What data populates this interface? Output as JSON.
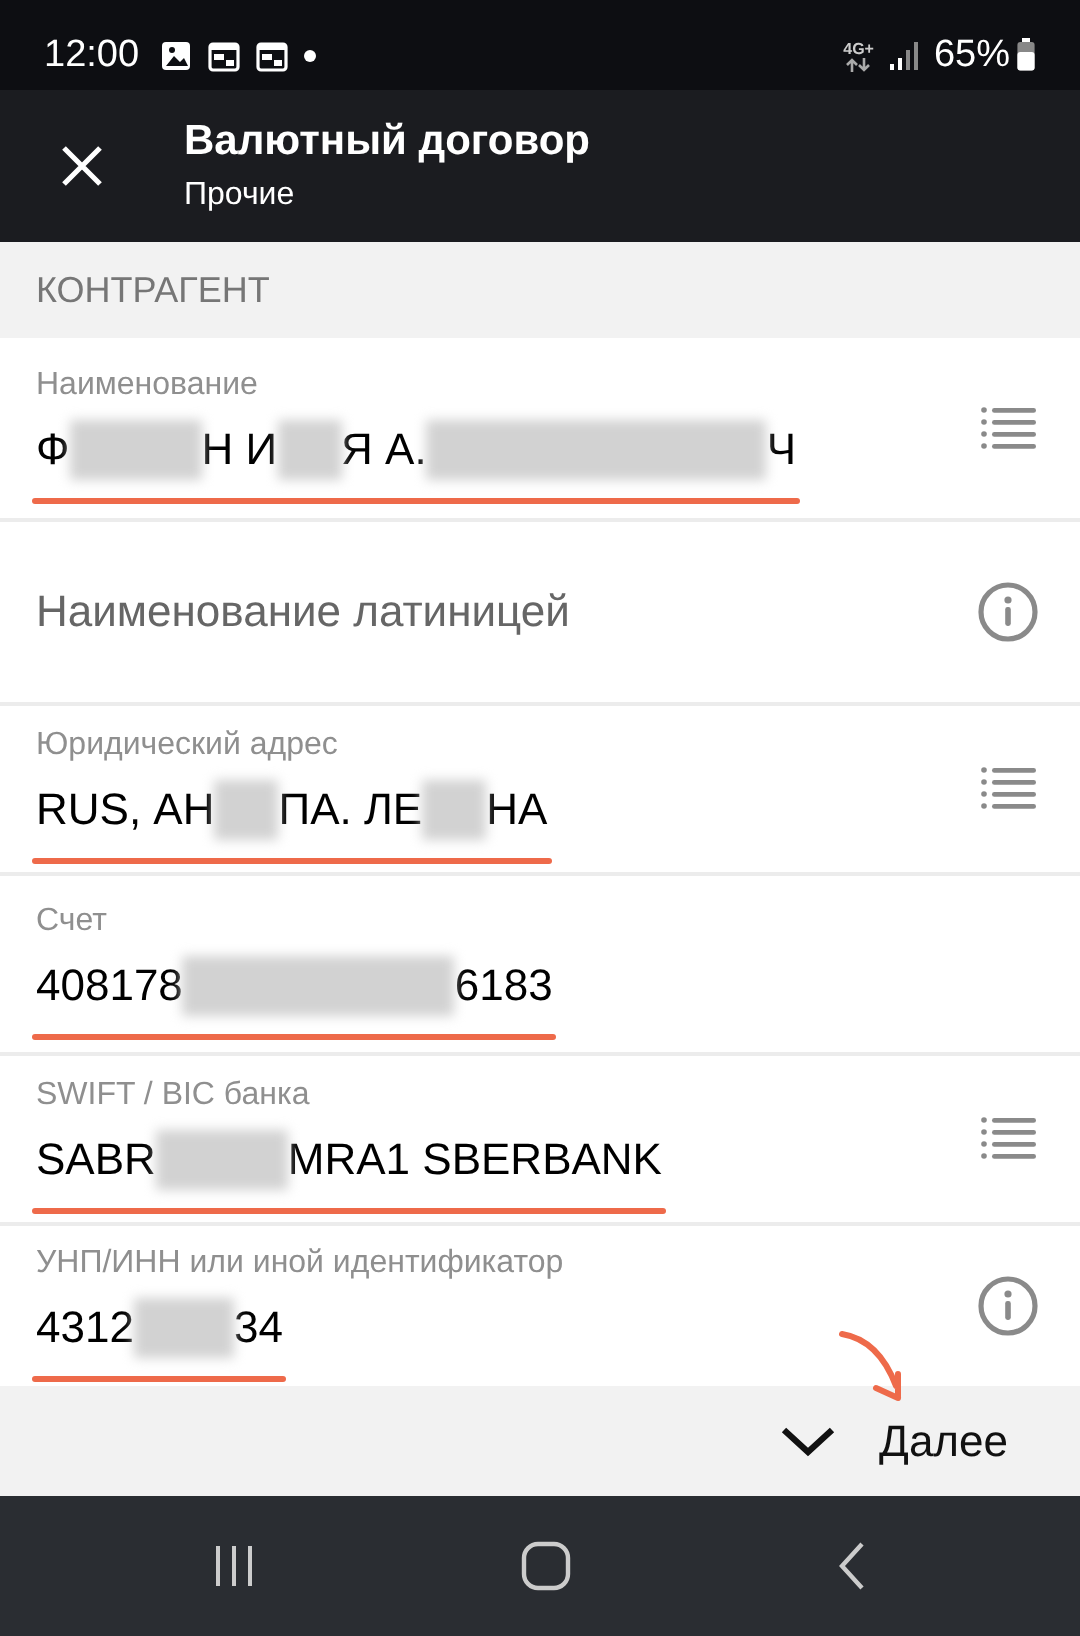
{
  "status_bar": {
    "time": "12:00",
    "network": "4G+",
    "battery": "65%"
  },
  "app_bar": {
    "title": "Валютный договор",
    "subtitle": "Прочие"
  },
  "section": {
    "title": "КОНТРАГЕНТ"
  },
  "fields": [
    {
      "kind": "list",
      "label": "Наименование",
      "underlined": true,
      "value": [
        {
          "kind": "text",
          "text": "Ф"
        },
        {
          "kind": "blur_l"
        },
        {
          "kind": "text",
          "text": "Н И"
        },
        {
          "kind": "blur_s"
        },
        {
          "kind": "text",
          "text": "Я А."
        },
        {
          "kind": "blur_xxl"
        },
        {
          "kind": "text",
          "text": "Ч"
        }
      ]
    },
    {
      "kind": "info",
      "placeholder": "Наименование латиницей"
    },
    {
      "kind": "list",
      "label": "Юридический адрес",
      "underlined": true,
      "value": [
        {
          "kind": "text",
          "text": "RUS, АН"
        },
        {
          "kind": "blur_s"
        },
        {
          "kind": "text",
          "text": "ПА. ЛЕ"
        },
        {
          "kind": "blur_s"
        },
        {
          "kind": "text",
          "text": "НА"
        }
      ]
    },
    {
      "kind": "plain",
      "label": "Счет",
      "underlined": true,
      "value": [
        {
          "kind": "text",
          "text": "408178"
        },
        {
          "kind": "blur_xl"
        },
        {
          "kind": "text",
          "text": "6183"
        }
      ]
    },
    {
      "kind": "list",
      "label": "SWIFT / BIC банка",
      "underlined": true,
      "value": [
        {
          "kind": "text",
          "text": "SABR"
        },
        {
          "kind": "blur_l"
        },
        {
          "kind": "text",
          "text": "MRA1 SBERBANK"
        }
      ]
    },
    {
      "kind": "info",
      "label": "УНП/ИНН или иной идентификатор",
      "underlined": true,
      "value": [
        {
          "kind": "text",
          "text": "4312"
        },
        {
          "kind": "blur_m"
        },
        {
          "kind": "text",
          "text": "34"
        }
      ]
    }
  ],
  "footer": {
    "next": "Далее",
    "arrow_annotation": true
  }
}
